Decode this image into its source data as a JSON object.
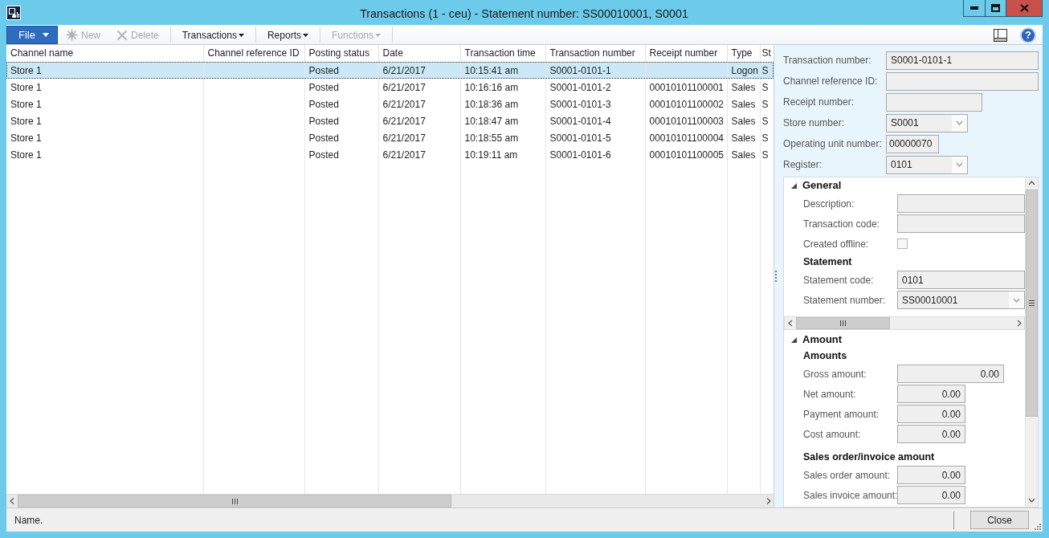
{
  "window": {
    "title": "Transactions (1 - ceu) - Statement number: SS00010001, S0001"
  },
  "toolbar": {
    "file_menu": "File",
    "new_button": {
      "label": "New",
      "disabled": true
    },
    "delete_button": {
      "label": "Delete",
      "disabled": true
    },
    "menus": [
      {
        "label": "Transactions",
        "disabled": false
      },
      {
        "label": "Reports",
        "disabled": false
      },
      {
        "label": "Functions",
        "disabled": true
      }
    ],
    "help_button": "?"
  },
  "table": {
    "columns": [
      "Channel name",
      "Channel reference ID",
      "Posting status",
      "Date",
      "Transaction time",
      "Transaction number",
      "Receipt number",
      "Type",
      "St"
    ],
    "rows": [
      {
        "selected": true,
        "cells": [
          "Store 1",
          null,
          "Posted",
          "6/21/2017",
          "10:15:41 am",
          "S0001-0101-1",
          null,
          "Logon",
          "S"
        ]
      },
      {
        "selected": false,
        "cells": [
          "Store 1",
          null,
          "Posted",
          "6/21/2017",
          "10:16:16 am",
          "S0001-0101-2",
          "00010101100001",
          "Sales",
          "S"
        ]
      },
      {
        "selected": false,
        "cells": [
          "Store 1",
          null,
          "Posted",
          "6/21/2017",
          "10:18:36 am",
          "S0001-0101-3",
          "00010101100002",
          "Sales",
          "S"
        ]
      },
      {
        "selected": false,
        "cells": [
          "Store 1",
          null,
          "Posted",
          "6/21/2017",
          "10:18:47 am",
          "S0001-0101-4",
          "00010101100003",
          "Sales",
          "S"
        ]
      },
      {
        "selected": false,
        "cells": [
          "Store 1",
          null,
          "Posted",
          "6/21/2017",
          "10:18:55 am",
          "S0001-0101-5",
          "00010101100004",
          "Sales",
          "S"
        ]
      },
      {
        "selected": false,
        "cells": [
          "Store 1",
          null,
          "Posted",
          "6/21/2017",
          "10:19:11 am",
          "S0001-0101-6",
          "00010101100005",
          "Sales",
          "S"
        ]
      }
    ]
  },
  "details": {
    "fields": [
      {
        "kind": "text",
        "label": "Transaction number:",
        "value": "S0001-0101-1"
      },
      {
        "kind": "text",
        "label": "Channel reference ID:"
      },
      {
        "kind": "text",
        "label": "Receipt number:"
      },
      {
        "kind": "dropdown",
        "label": "Store number:",
        "value": "S0001"
      },
      {
        "kind": "text",
        "label": "Operating unit number:",
        "value": "00000070"
      },
      {
        "kind": "dropdown",
        "label": "Register:",
        "value": "0101"
      }
    ],
    "sections": [
      {
        "title": "General",
        "expanded": true,
        "items": [
          {
            "kind": "text",
            "label": "Description:"
          },
          {
            "kind": "text",
            "label": "Transaction code:"
          },
          {
            "kind": "checkbox",
            "label": "Created offline:",
            "checked": false
          },
          {
            "kind": "heading",
            "label": "Statement"
          },
          {
            "kind": "text",
            "label": "Statement code:",
            "value": "0101"
          },
          {
            "kind": "dropdown",
            "label": "Statement number:",
            "value": "SS00010001"
          }
        ]
      },
      {
        "title": "Amount",
        "expanded": true,
        "items": [
          {
            "kind": "heading",
            "label": "Amounts"
          },
          {
            "kind": "amount",
            "label": "Gross amount:",
            "value": "0.00"
          },
          {
            "kind": "amount",
            "label": "Net amount:",
            "value": "0.00"
          },
          {
            "kind": "amount",
            "label": "Payment amount:",
            "value": "0.00"
          },
          {
            "kind": "amount",
            "label": "Cost amount:",
            "value": "0.00"
          },
          {
            "kind": "heading",
            "label": "Sales order/invoice amount"
          },
          {
            "kind": "amount",
            "label": "Sales order amount:",
            "value": "0.00"
          },
          {
            "kind": "amount",
            "label": "Sales invoice amount:",
            "value": "0.00"
          }
        ]
      }
    ]
  },
  "status_bar": {
    "text": "Name.",
    "close_button": "Close"
  }
}
